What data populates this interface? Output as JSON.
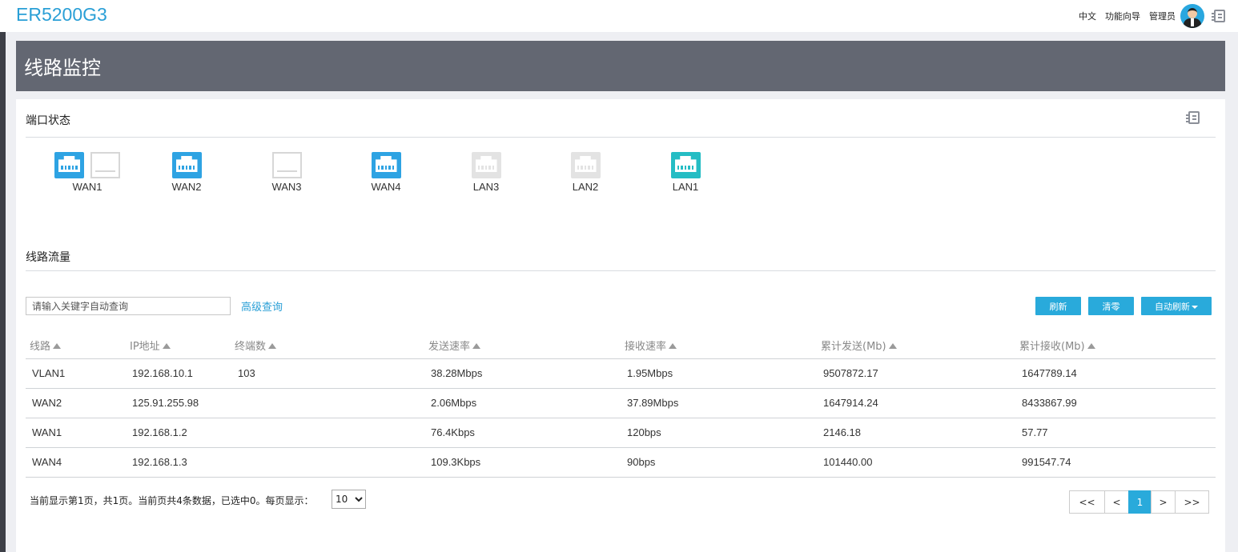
{
  "header": {
    "brand": "ER5200G3",
    "lang": "中文",
    "wizard": "功能向导",
    "admin": "管理员"
  },
  "page_title": "线路监控",
  "port_status": {
    "title": "端口状态",
    "ports": [
      {
        "label": "WAN1",
        "state": "connected",
        "color": "#2ea3e3",
        "sfp": true
      },
      {
        "label": "WAN2",
        "state": "connected",
        "color": "#2ea3e3",
        "sfp": false
      },
      {
        "label": "WAN3",
        "state": "sfp-idle",
        "color": "#d7d7d7",
        "sfp": true
      },
      {
        "label": "WAN4",
        "state": "connected",
        "color": "#2ea3e3",
        "sfp": false
      },
      {
        "label": "LAN3",
        "state": "disconnected",
        "color": "#e3e3e3",
        "sfp": false
      },
      {
        "label": "LAN2",
        "state": "disconnected",
        "color": "#e3e3e3",
        "sfp": false
      },
      {
        "label": "LAN1",
        "state": "connected",
        "color": "#25bdc4",
        "sfp": false
      }
    ]
  },
  "traffic": {
    "title": "线路流量",
    "search_placeholder": "请输入关键字自动查询",
    "advanced_query": "高级查询",
    "buttons": {
      "refresh": "刷新",
      "clear": "清零",
      "auto_refresh": "自动刷新"
    },
    "columns": [
      "线路",
      "IP地址",
      "终端数",
      "发送速率",
      "接收速率",
      "累计发送(Mb)",
      "累计接收(Mb)"
    ],
    "rows": [
      [
        "VLAN1",
        "192.168.10.1",
        "103",
        "38.28Mbps",
        "1.95Mbps",
        "9507872.17",
        "1647789.14"
      ],
      [
        "WAN2",
        "125.91.255.98",
        "",
        "2.06Mbps",
        "37.89Mbps",
        "1647914.24",
        "8433867.99"
      ],
      [
        "WAN1",
        "192.168.1.2",
        "",
        "76.4Kbps",
        "120bps",
        "2146.18",
        "57.77"
      ],
      [
        "WAN4",
        "192.168.1.3",
        "",
        "109.3Kbps",
        "90bps",
        "101440.00",
        "991547.74"
      ]
    ]
  },
  "footer": {
    "info": "当前显示第1页，共1页。当前页共4条数据，已选中0。每页显示：",
    "page_size": "10",
    "pager": {
      "first": "<<",
      "prev": "<",
      "current": "1",
      "next": ">",
      "last": ">>"
    }
  },
  "colors": {
    "accent": "#29aadb",
    "brand": "#2a9fd6",
    "banner": "#636772"
  }
}
